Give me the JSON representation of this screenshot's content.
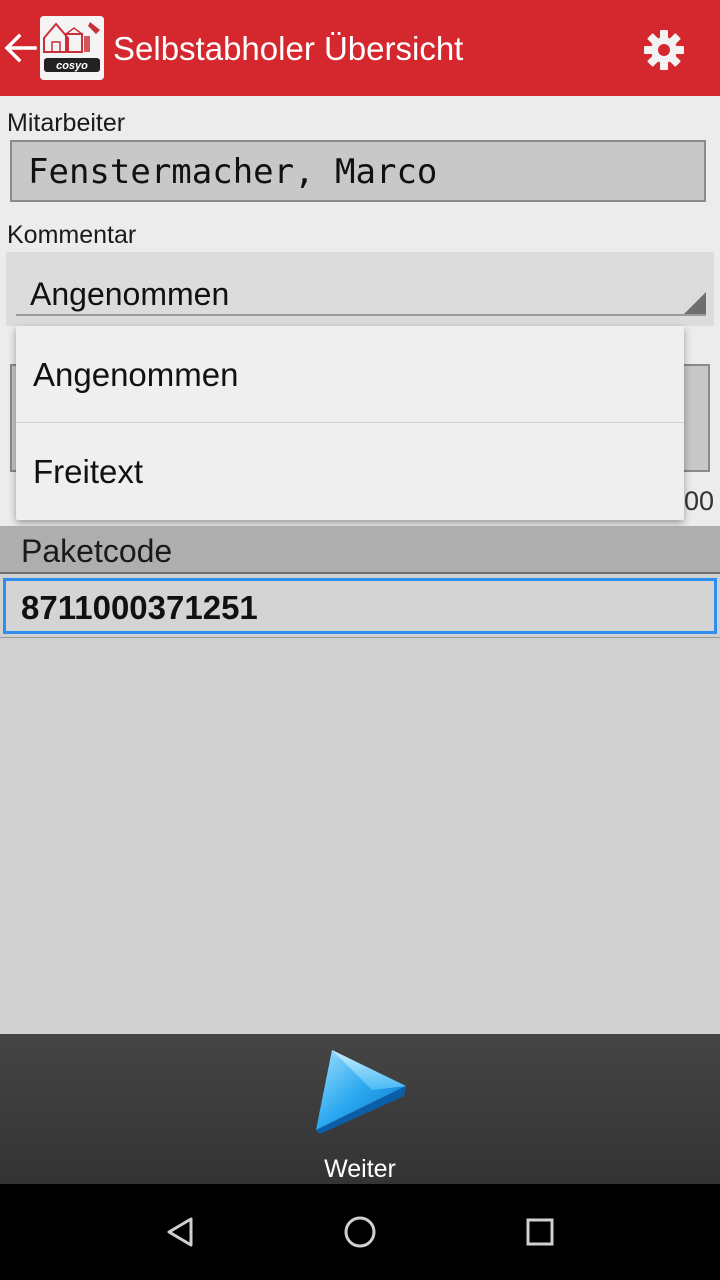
{
  "app_bar": {
    "title": "Selbstabholer Übersicht",
    "back_icon": "arrow-left-icon",
    "settings_icon": "gear-icon",
    "background_color": "#d4282e"
  },
  "form": {
    "employee_label": "Mitarbeiter",
    "employee_value": "Fenstermacher, Marco",
    "comment_label": "Kommentar",
    "comment_selected": "Angenommen",
    "counter_text": "00"
  },
  "dropdown": {
    "options": [
      "Angenommen",
      "Freitext"
    ]
  },
  "package": {
    "header": "Paketcode",
    "code": "8711000371251"
  },
  "bottom_bar": {
    "next_label": "Weiter",
    "next_icon": "play-arrow-icon"
  },
  "system_nav": {
    "back_icon": "nav-back-icon",
    "home_icon": "nav-home-icon",
    "recents_icon": "nav-recents-icon"
  }
}
